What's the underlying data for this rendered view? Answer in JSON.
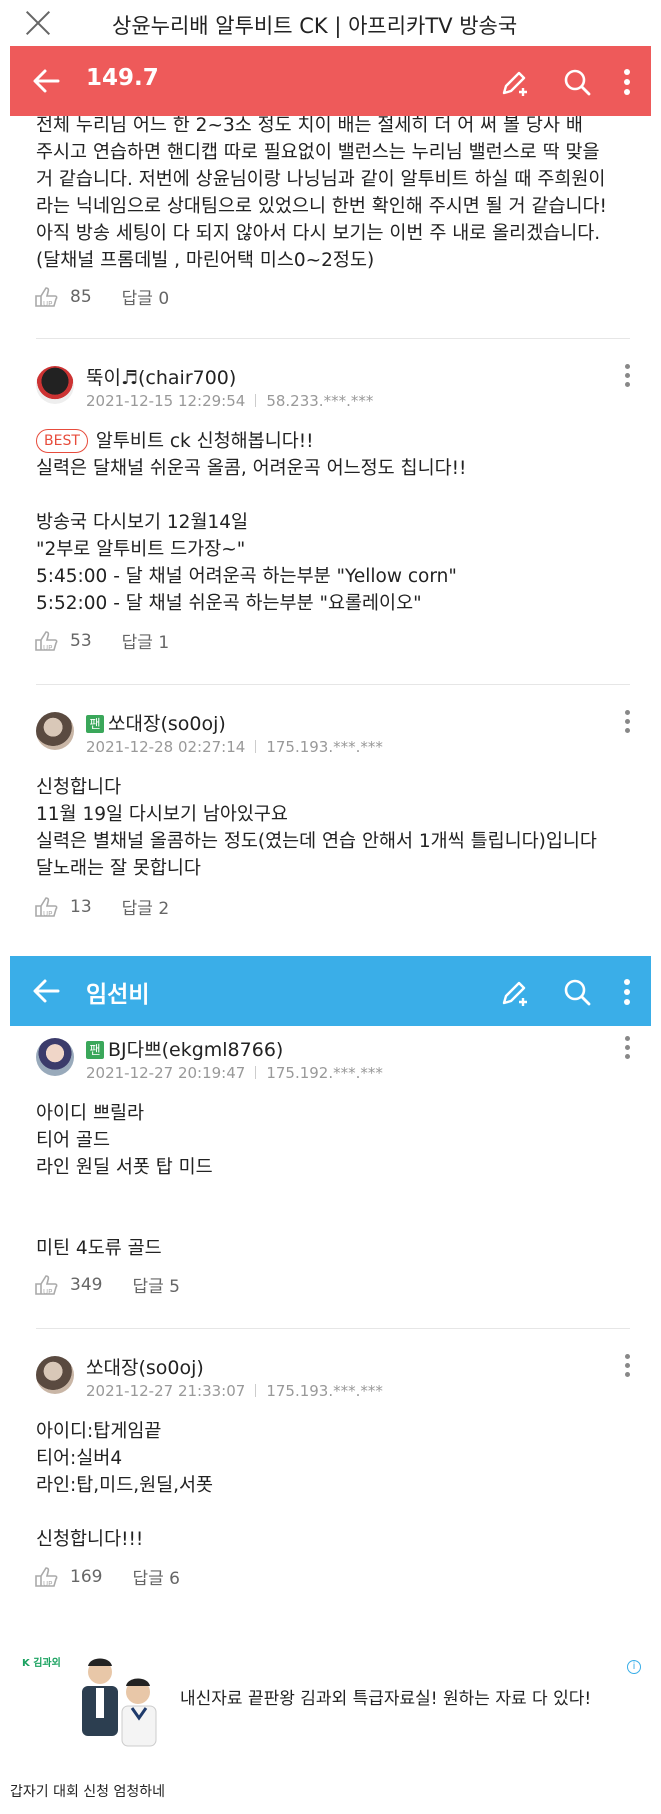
{
  "browser": {
    "title": "상윤누리배 알투비트 CK | 아프리카TV 방송국"
  },
  "panel1": {
    "title": "149.7",
    "colors": {
      "bar": "#ee5a5a"
    },
    "top_text": "전체 누리님 어느 한 2~3소 정도 치이 배는 절세히 더 어 써 볼 당사 배\n주시고 연습하면 핸디캡 따로 필요없이 밸런스는 누리님 밸런스로 딱 맞을\n거 같습니다. 저번에 상윤님이랑 나닝님과 같이 알투비트 하실 때 주희원이\n라는 닉네임으로 상대팀으로 있었으니 한번 확인해 주시면 될 거 같습니다!\n아직 방송 세팅이 다 되지 않아서 다시 보기는 이번 주 내로 올리겠습니다.\n(달채널 프롬데빌 , 마린어택 미스0~2정도)",
    "top_likes": "85",
    "top_replies": "답글 0",
    "comments": [
      {
        "name": "뚝이♬(chair700)",
        "date": "2021-12-15 12:29:54",
        "ip": "58.233.***.***",
        "badge": "BEST",
        "first_line": "알투비트 ck 신청해봅니다!!",
        "body": "실력은 달채널 쉬운곡 올콤, 어려운곡 어느정도 칩니다!!\n\n방송국 다시보기 12월14일\n\"2부로 알투비트 드가장~\"\n5:45:00 - 달 채널 어려운곡 하는부분 \"Yellow corn\"\n5:52:00 - 달 채널 쉬운곡 하는부분 \"요롤레이오\"",
        "likes": "53",
        "replies": "답글 1"
      },
      {
        "name": "쏘대장(so0oj)",
        "fan": "팬",
        "date": "2021-12-28 02:27:14",
        "ip": "175.193.***.***",
        "body": "신청합니다\n11월 19일 다시보기 남아있구요\n실력은 별채널 올콤하는 정도(였는데 연습 안해서 1개씩 틀립니다)입니다\n달노래는 잘 못합니다",
        "likes": "13",
        "replies": "답글 2"
      }
    ]
  },
  "panel2": {
    "title": "임선비",
    "colors": {
      "bar": "#3aaee8"
    },
    "comments": [
      {
        "name": "BJ다쁘(ekgml8766)",
        "fan": "팬",
        "date": "2021-12-27 20:19:47",
        "ip": "175.192.***.***",
        "body": "아이디 쁘릴라\n티어 골드\n라인 원딜 서폿 탑 미드\n\n\n미틴 4도류 골드",
        "likes": "349",
        "replies": "답글 5"
      },
      {
        "name": "쏘대장(so0oj)",
        "date": "2021-12-27 21:33:07",
        "ip": "175.193.***.***",
        "body": "아이디:탑게임끝\n티어:실버4\n라인:탑,미드,원딜,서폿\n\n신청합니다!!!",
        "likes": "169",
        "replies": "답글 6"
      }
    ]
  },
  "ad": {
    "logo": "K 김과외",
    "text": "내신자료 끝판왕 김과외 특급자료실! 원하는 자료 다 있다!",
    "info": "i"
  },
  "caption": "갑자기 대회 신청 엄청하네"
}
